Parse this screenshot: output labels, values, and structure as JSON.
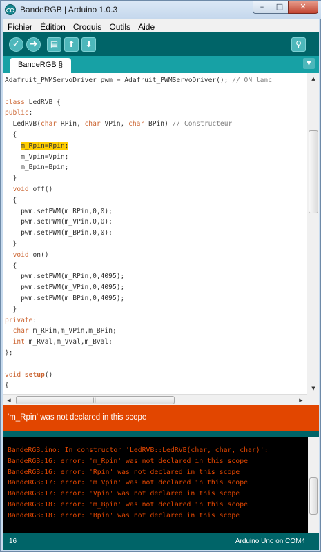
{
  "window": {
    "title": "BandeRGB | Arduino 1.0.3",
    "minimize_glyph": "–",
    "maximize_glyph": "□",
    "close_glyph": "✕"
  },
  "menu": [
    "Fichier",
    "Édition",
    "Croquis",
    "Outils",
    "Aide"
  ],
  "toolbar": {
    "verify_icon": "check-icon",
    "upload_icon": "arrow-right-icon",
    "new_icon": "new-file-icon",
    "open_icon": "arrow-up-icon",
    "save_icon": "arrow-down-icon",
    "serial_icon": "magnifier-icon",
    "verify_glyph": "✓",
    "upload_glyph": "➜",
    "new_glyph": "▤",
    "open_glyph": "⬆",
    "save_glyph": "⬇",
    "serial_glyph": "⚲"
  },
  "tab": {
    "label": "BandeRGB §",
    "menu_glyph": "▼"
  },
  "editor": {
    "highlight_line_index": 6,
    "lines": [
      "Adafruit_PWMServoDriver pwm = Adafruit_PWMServoDriver(); // ON lanc",
      "",
      "class LedRVB {",
      "public:",
      "  LedRVB(char RPin, char VPin, char BPin) // Constructeur",
      "  {",
      "    m_Rpin=Rpin;",
      "    m_Vpin=Vpin;",
      "    m_Bpin=Bpin;",
      "  }",
      "  void off()",
      "  {",
      "    pwm.setPWM(m_RPin,0,0);",
      "    pwm.setPWM(m_VPin,0,0);",
      "    pwm.setPWM(m_BPin,0,0);",
      "  }",
      "  void on()",
      "  {",
      "    pwm.setPWM(m_RPin,0,4095);",
      "    pwm.setPWM(m_VPin,0,4095);",
      "    pwm.setPWM(m_BPin,0,4095);",
      "  }",
      "private:",
      "  char m_RPin,m_VPin,m_BPin;",
      "  int m_Rval,m_Vval,m_Bval;",
      "};",
      "",
      "void setup()",
      "{"
    ]
  },
  "status_message": "'m_Rpin' was not declared in this scope",
  "console": [
    "BandeRGB.ino: In constructor 'LedRVB::LedRVB(char, char, char)':",
    "BandeRGB:16: error: 'm_Rpin' was not declared in this scope",
    "BandeRGB:16: error: 'Rpin' was not declared in this scope",
    "BandeRGB:17: error: 'm_Vpin' was not declared in this scope",
    "BandeRGB:17: error: 'Vpin' was not declared in this scope",
    "BandeRGB:18: error: 'm_Bpin' was not declared in this scope",
    "BandeRGB:18: error: 'Bpin' was not declared in this scope"
  ],
  "footer": {
    "line_number": "16",
    "board": "Arduino Uno on COM4"
  },
  "colors": {
    "toolbar": "#006468",
    "tabstrip": "#17a1a5",
    "error": "#e24600",
    "highlight": "#ffce00",
    "keyword": "#cc6633"
  }
}
